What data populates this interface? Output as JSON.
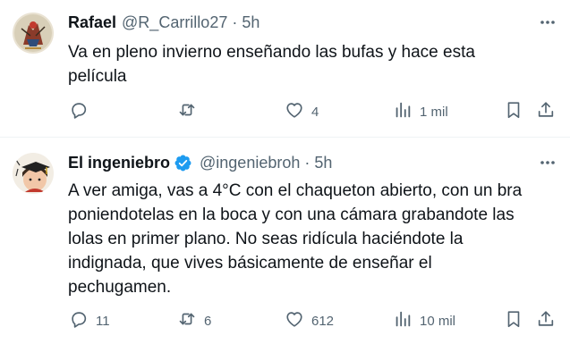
{
  "tweets": [
    {
      "author_name": "Rafael",
      "handle": "@R_Carrillo27",
      "separator": "·",
      "time": "5h",
      "verified": false,
      "text": "Va en pleno invierno enseñando las bufas y hace esta\npelícula",
      "stats": {
        "replies": "",
        "retweets": "",
        "likes": "4",
        "views": "1 mil"
      }
    },
    {
      "author_name": "El ingeniebro",
      "handle": "@ingeniebroh",
      "separator": "·",
      "time": "5h",
      "verified": true,
      "text": "A ver amiga, vas a 4°C con el chaqueton abierto, con un bra\nponiendotelas en la boca y con una cámara grabandote las\nlolas en primer plano. No seas ridícula haciéndote la\nindignada, que vives básicamente de enseñar el\npechugamen.",
      "stats": {
        "replies": "11",
        "retweets": "6",
        "likes": "612",
        "views": "10 mil"
      }
    }
  ],
  "colors": {
    "text": "#0f1419",
    "secondary": "#536471",
    "verified": "#1d9bf0",
    "divider": "#eff3f4"
  },
  "icons": [
    "reply-icon",
    "retweet-icon",
    "like-icon",
    "views-icon",
    "bookmark-icon",
    "share-icon",
    "more-icon",
    "verified-badge-icon"
  ]
}
